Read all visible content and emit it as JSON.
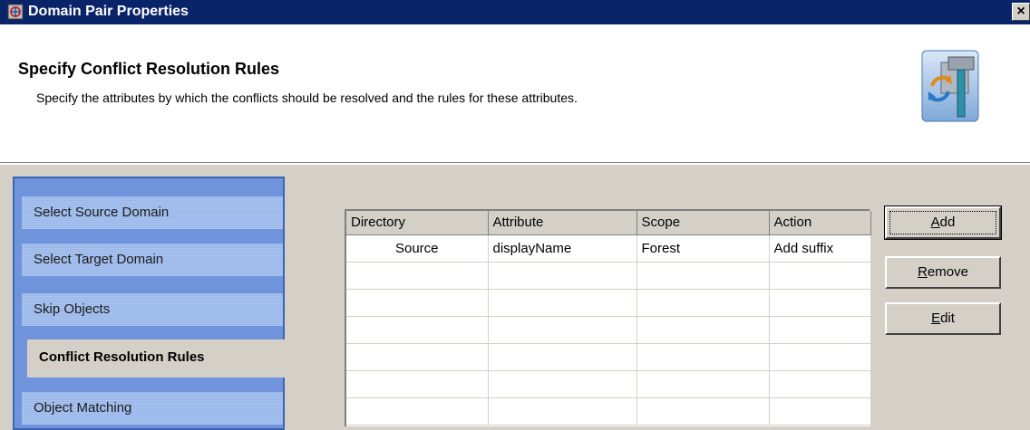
{
  "window": {
    "title": "Domain Pair Properties",
    "close_glyph": "×"
  },
  "header": {
    "title": "Specify Conflict Resolution Rules",
    "subtitle": "Specify the attributes by which the conflicts should be resolved and the rules for these attributes.",
    "icon": "wizard-tools-icon"
  },
  "sidebar": {
    "items": [
      {
        "label": "Select Source Domain"
      },
      {
        "label": "Select Target Domain"
      },
      {
        "label": "Skip Objects"
      },
      {
        "label": "Conflict Resolution Rules",
        "active": true
      },
      {
        "label": "Object Matching"
      }
    ]
  },
  "table": {
    "columns": [
      "Directory",
      "Attribute",
      "Scope",
      "Action"
    ],
    "rows": [
      [
        "Source",
        "displayName",
        "Forest",
        "Add suffix"
      ]
    ]
  },
  "buttons": {
    "add": {
      "first": "A",
      "rest": "dd"
    },
    "remove": {
      "first": "R",
      "rest": "emove"
    },
    "edit": {
      "first": "E",
      "rest": "dit"
    }
  },
  "colors": {
    "titlebar": "#0a246a",
    "sidebar": "#6f94dc",
    "face": "#d4d0c8"
  }
}
